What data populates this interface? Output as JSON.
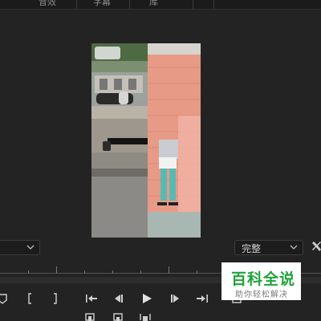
{
  "menu": {
    "items": [
      "音效",
      "字幕",
      "库"
    ]
  },
  "preview": {
    "description_icon": "video-frame",
    "tiktok_logo": "tiktok-icon"
  },
  "left_dropdown": {
    "value": ""
  },
  "quality_dropdown": {
    "value": "完整",
    "icon": "chevron-down-icon"
  },
  "settings": {
    "icon": "wrench-icon"
  },
  "transport": {
    "row1": [
      "add-marker-icon",
      "mark-in-icon",
      "mark-out-icon",
      "go-to-in-icon",
      "step-back-icon",
      "play-icon",
      "step-forward-icon",
      "go-to-out-icon",
      "export-frame-icon"
    ],
    "row2": [
      "insert-icon",
      "overwrite-icon",
      "lift-icon"
    ]
  },
  "watermark": {
    "title": "百科全说",
    "subtitle": "助你轻松解决"
  }
}
